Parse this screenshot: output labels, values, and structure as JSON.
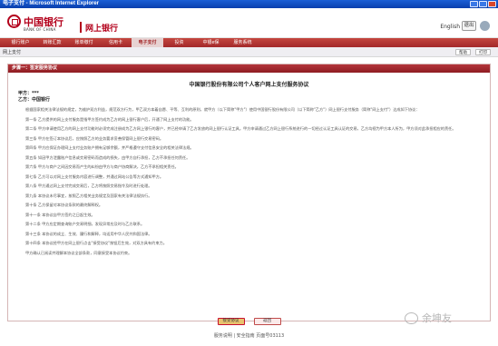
{
  "window": {
    "title": "电子支付 - Microsoft Internet Explorer"
  },
  "header": {
    "logo_cn": "中国银行",
    "logo_en": "BANK OF CHINA",
    "product": "网上银行",
    "language": "English",
    "logout": "退出"
  },
  "nav": {
    "items": [
      "银行账户",
      "转账汇款",
      "账单缴付",
      "信用卡",
      "电子支付",
      "投资",
      "中银e保",
      "服务系统"
    ],
    "active_index": 4
  },
  "subbar": {
    "label": "网上支付",
    "buttons": [
      "帮助",
      "打印"
    ]
  },
  "panel": {
    "header": "步骤一：签定服务协议",
    "doc_title": "中国银行股份有限公司个人客户网上支付服务协议",
    "party_a": "甲方：***",
    "party_b": "乙方：中国银行",
    "clauses": [
      "根据国家相关法律法规的规定，为维护双方利益，规范双方行为，甲乙双方本着自愿、平等、互利的原则，就甲方（以下简称\"甲方\"）使用中国银行股份有限公司（以下简称\"乙方\"）网上银行支付服务（简称\"网上支付\"）达成如下协议：",
      "第一条  乙方提供的网上支付服务是指甲方签约成为乙方的网上银行客户后，开通了网上支付的功能。",
      "第二条  甲方申请使用乙方的网上支付功能时必须完成注册成为乙方网上银行的客户，并已经申请了乙方发放的网上银行认证工具。甲方申请通过乙方网上银行系统进行的一切经过认证工具认证的交易，乙方均视为甲方本人所为，甲方须对此承担相应的责任。",
      "第三条  甲方在签订本协议后，应按照乙方的业务要求妥善保管网上银行交易密码。",
      "第四条  甲方应保证办理网上支付业务账户拥有足够余额，并严格遵守支付信息安全的相关法律法规。",
      "第五条  如因甲方泄露账户信息或交易密码而造成的损失，由甲方自行承担，乙方不承担任何责任。",
      "第六条  甲方与商户之间因交易而产生的纠纷由甲方与商户协商解决，乙方不承担相关责任。",
      "第七条  乙方可以对网上支付服务内容进行调整，并通过网站公告等方式通知甲方。",
      "第八条  甲方通过网上支付完成交易后，乙方将按照交易指令及时进行处理。",
      "第九条  本协议未尽事宜，按照乙方相关业务规定及国家有关法律法规执行。",
      "第十条  乙方保留对本协议条款的最终解释权。",
      "第十一条  本协议自甲方签约之日起生效。",
      "第十二条  甲方应定期查询账户交易明细，发现异常应及时与乙方联系。",
      "第十三条  本协议的成立、生效、履行和解释，均适用中华人民共和国法律。",
      "第十四条  本协议经甲方在网上银行点击\"接受协议\"按钮后生效，对双方具有约束力。",
      "甲方确认已阅读并理解本协议全部条款，同意接受本协议约束。"
    ],
    "accept_button": "接受协议",
    "back_button": "返回"
  },
  "footer": {
    "text": "服务说明  |  安全指南  页面号03113"
  },
  "watermark": {
    "text": "余坤友"
  }
}
